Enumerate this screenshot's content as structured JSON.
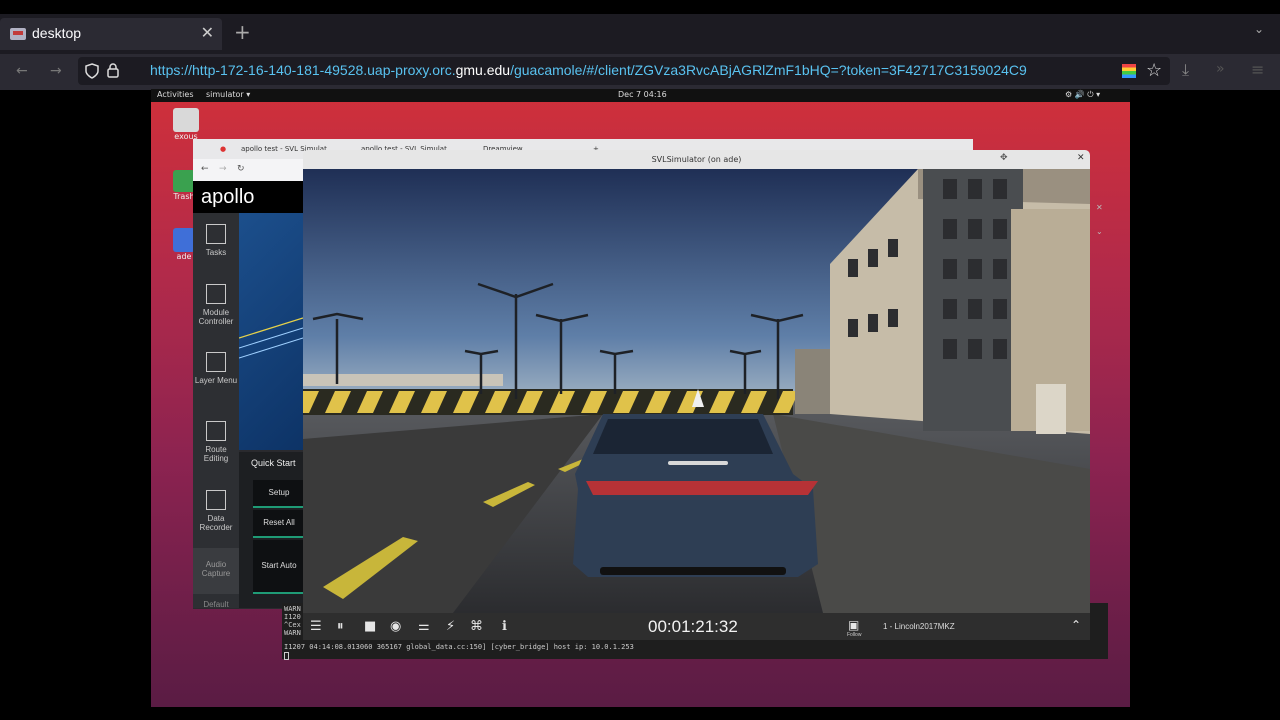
{
  "browser": {
    "tab_title": "desktop",
    "url_prefix": "https://http-172-16-140-181-49528.uap-proxy.orc.",
    "url_domain": "gmu.edu",
    "url_suffix": "/guacamole/#/client/ZGVza3RvcABjAGRlZmF1bHQ=?token=3F42717C3159024C9"
  },
  "gnome": {
    "activities": "Activities",
    "app_menu": "simulator ▾",
    "clock": "Dec 7  04:16"
  },
  "desktop_icons": [
    "exous",
    "Trash",
    "ade"
  ],
  "vm_firefox": {
    "tabs": [
      "apollo test - SVL Simulat",
      "apollo test - SVL Simulat",
      "Dreamview"
    ]
  },
  "apollo": {
    "logo": "apollo",
    "nav": [
      {
        "label": "Tasks"
      },
      {
        "label": "Module Controller"
      },
      {
        "label": "Layer Menu"
      },
      {
        "label": "Route Editing"
      },
      {
        "label": "Data Recorder"
      },
      {
        "label": "Audio Capture"
      },
      {
        "label": "Default"
      }
    ],
    "quick_start": "Quick Start",
    "buttons": [
      "Setup",
      "Reset All",
      "Start Auto"
    ]
  },
  "simulator": {
    "title": "SVLSimulator (on ade)",
    "time": "00:01:21:32",
    "follow": "Follow",
    "vehicle": "1 - Lincoln2017MKZ"
  },
  "terminal": {
    "lines": [
      "WARN",
      "I120",
      "^Cex",
      "WARN",
      "I1207 04:14:08.013060 365167 global_data.cc:150] [cyber_bridge] host ip: 10.0.1.253"
    ]
  }
}
